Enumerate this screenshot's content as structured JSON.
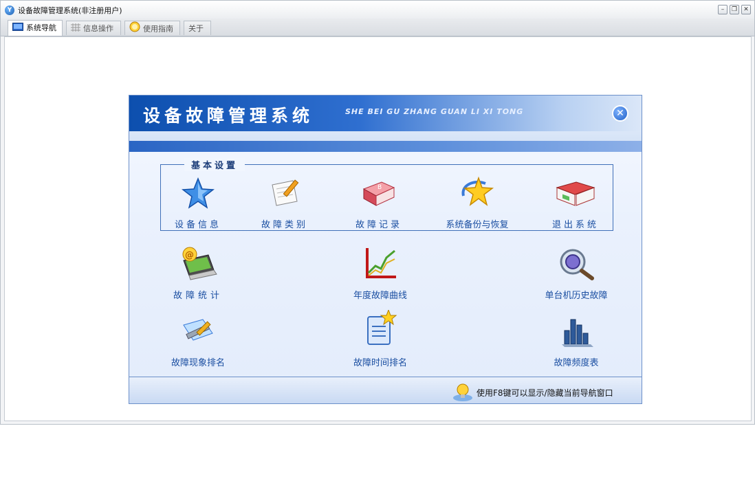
{
  "window": {
    "title": "设备故障管理系统(非注册用户)",
    "app_icon_glyph": "Y",
    "controls": {
      "minimize": "–",
      "restore": "❐",
      "close": "✕"
    }
  },
  "tabs": [
    {
      "label": "系统导航",
      "icon": "monitor-icon",
      "active": true
    },
    {
      "label": "信息操作",
      "icon": "grid-icon",
      "active": false
    },
    {
      "label": "使用指南",
      "icon": "smile-icon",
      "active": false
    },
    {
      "label": "关于",
      "icon": "",
      "active": false
    }
  ],
  "panel": {
    "title": "设备故障管理系统",
    "subtitle": "SHE BEI GU ZHANG GUAN LI XI TONG",
    "close_glyph": "✕",
    "group_title": "基本设置",
    "group_items": [
      {
        "label": "设备信息",
        "icon": "star-icon"
      },
      {
        "label": "故障类别",
        "icon": "notepad-pencil-icon"
      },
      {
        "label": "故障记录",
        "icon": "book-icon"
      },
      {
        "label": "系统备份与恢复",
        "icon": "star-swirl-icon"
      },
      {
        "label": "退出系统",
        "icon": "open-book-icon"
      }
    ],
    "items_row1": [
      {
        "label": "故障统计",
        "icon": "laptop-at-icon"
      },
      {
        "label": "年度故障曲线",
        "icon": "line-chart-icon"
      },
      {
        "label": "单台机历史故障",
        "icon": "magnifier-icon"
      }
    ],
    "items_row2": [
      {
        "label": "故障现象排名",
        "icon": "tools-icon"
      },
      {
        "label": "故障时间排名",
        "icon": "document-star-icon"
      },
      {
        "label": "故障频度表",
        "icon": "bar-chart-icon"
      }
    ],
    "footer_hint": "使用F8键可以显示/隐藏当前导航窗口"
  },
  "colors": {
    "accent_blue": "#1a4ea1",
    "banner_dark": "#0d4fae",
    "panel_bg": "#eaf1fd"
  }
}
